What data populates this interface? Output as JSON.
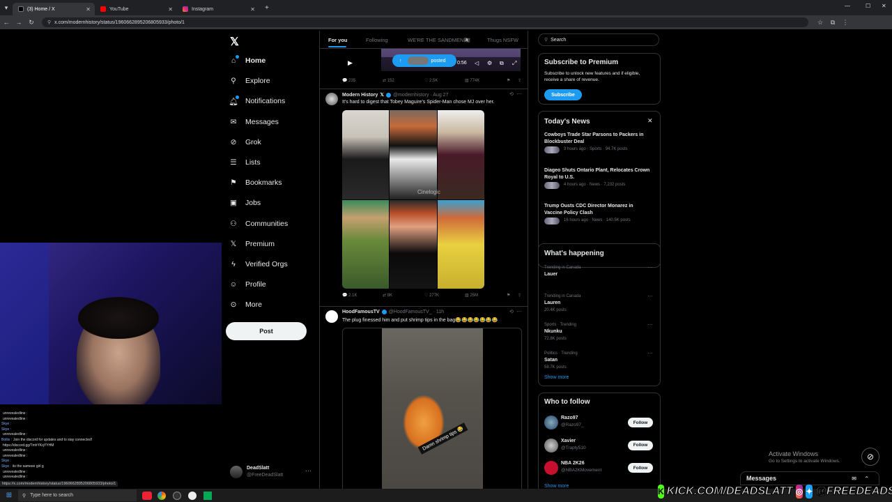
{
  "browser": {
    "tabs": [
      {
        "label": "(3) Home / X",
        "active": true
      },
      {
        "label": "YouTube",
        "active": false
      },
      {
        "label": "Instagram",
        "active": false
      }
    ],
    "new_tab": "+",
    "url": "x.com/modernhistory/status/1960662895206805933/photo/1",
    "status_url": "https://x.com/modernhistory/status/1960662895206805933/photo/1"
  },
  "nav": {
    "items": [
      {
        "label": "Home",
        "icon": "home-icon"
      },
      {
        "label": "Explore",
        "icon": "search-icon"
      },
      {
        "label": "Notifications",
        "icon": "bell-icon"
      },
      {
        "label": "Messages",
        "icon": "mail-icon"
      },
      {
        "label": "Grok",
        "icon": "grok-icon"
      },
      {
        "label": "Lists",
        "icon": "list-icon"
      },
      {
        "label": "Bookmarks",
        "icon": "bookmark-icon"
      },
      {
        "label": "Jobs",
        "icon": "briefcase-icon"
      },
      {
        "label": "Communities",
        "icon": "people-icon"
      },
      {
        "label": "Premium",
        "icon": "x-logo-icon"
      },
      {
        "label": "Verified Orgs",
        "icon": "lightning-icon"
      },
      {
        "label": "Profile",
        "icon": "person-icon"
      },
      {
        "label": "More",
        "icon": "more-circle-icon"
      }
    ],
    "post_label": "Post",
    "account": {
      "name": "DeadSlatt",
      "handle": "@FreeDeadSlatt",
      "menu": "···"
    }
  },
  "feed": {
    "tabs": [
      "For you",
      "Following",
      "WE'RE THE SANDMEN🏴‍☠️",
      "Thugs NSFW"
    ],
    "video": {
      "time": "0:56",
      "posted": "posted"
    },
    "tweet0_actions": {
      "replies": "235",
      "reposts": "152",
      "likes": "2.5K",
      "views": "774K"
    },
    "tweet1": {
      "name": "Modern History",
      "handle": "@modernhistory · Aug 27",
      "text": "It's hard to digest that Tobey Maguire's Spider-Man chose MJ over her.",
      "watermark": "Cinelogic",
      "actions": {
        "replies": "2.1K",
        "reposts": "8K",
        "likes": "277K",
        "views": "25M"
      }
    },
    "tweet2": {
      "name": "HoodFamousTV",
      "handle": "@HoodFamousTV_ · 11h",
      "text": "The plug finessed him and put shrimp tips in the bag😂😂😂😂😂😂😂",
      "caption": "Damn shrimp tips 😂"
    }
  },
  "right": {
    "search_placeholder": "Search",
    "premium": {
      "title": "Subscribe to Premium",
      "text": "Subscribe to unlock new features and if eligible, receive a share of revenue.",
      "button": "Subscribe"
    },
    "news": {
      "title": "Today's News",
      "items": [
        {
          "headline": "Cowboys Trade Star Parsons to Packers in Blockbuster Deal",
          "meta": "3 hours ago · Sports · 94.7K posts"
        },
        {
          "headline": "Diageo Shuts Ontario Plant, Relocates Crown Royal to U.S.",
          "meta": "4 hours ago · News · 7,232 posts"
        },
        {
          "headline": "Trump Ousts CDC Director Monarez in Vaccine Policy Clash",
          "meta": "16 hours ago · News · 140.5K posts"
        }
      ]
    },
    "happening": {
      "title": "What's happening",
      "items": [
        {
          "context": "Trending in Canada",
          "topic": "Lauer",
          "posts": ""
        },
        {
          "context": "Trending in Canada",
          "topic": "Lauren",
          "posts": "20.4K posts"
        },
        {
          "context": "Sports · Trending",
          "topic": "Nkunku",
          "posts": "72.8K posts"
        },
        {
          "context": "Politics · Trending",
          "topic": "Satan",
          "posts": "58.7K posts"
        }
      ],
      "show_more": "Show more"
    },
    "who_to_follow": {
      "title": "Who to follow",
      "items": [
        {
          "name": "Razo97",
          "handle": "@Razo97_",
          "button": "Follow"
        },
        {
          "name": "Xavier",
          "handle": "@Trapty510",
          "button": "Follow"
        },
        {
          "name": "NBA 2K26",
          "handle": "@NBA2KMovement",
          "button": "Follow"
        }
      ],
      "show_more": "Show more"
    }
  },
  "messages_drawer": "Messages",
  "activate": {
    "title": "Activate Windows",
    "sub": "Go to Settings to activate Windows."
  },
  "chat": [
    {
      "user": "",
      "text": "unrevealedline :"
    },
    {
      "user": "",
      "text": "unrevealedline :"
    },
    {
      "user": "Skye :",
      "text": ""
    },
    {
      "user": "Skye :",
      "text": ""
    },
    {
      "user": "",
      "text": "unrevealedline :"
    },
    {
      "user": "Botlix :",
      "text": "Join the discord for updates and to stay connected!"
    },
    {
      "user": "",
      "text": "https://discord.gg/TmhYKqYYHM"
    },
    {
      "user": "",
      "text": "unrevealedline :"
    },
    {
      "user": "",
      "text": "unrevealedline :"
    },
    {
      "user": "Skye :",
      "text": ""
    },
    {
      "user": "Skye :",
      "text": "its the sameee girl g"
    },
    {
      "user": "",
      "text": "unrevealedline :"
    },
    {
      "user": "",
      "text": "unrevealedline :"
    }
  ],
  "taskbar": {
    "search_placeholder": "Type here to search"
  },
  "overlay": {
    "kick": "KICK.COM/DEADSLATT",
    "handle": "@FREEDEADSLATT"
  },
  "colors": {
    "accent": "#1d9bf0",
    "background": "#000000",
    "border": "#2f3336"
  }
}
